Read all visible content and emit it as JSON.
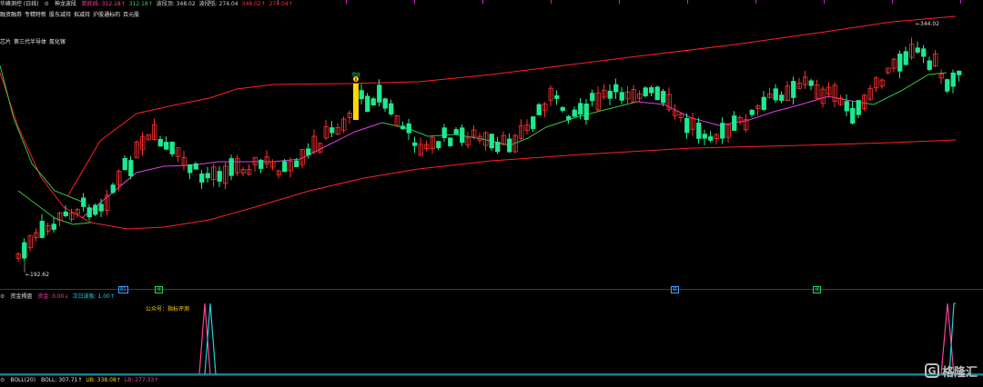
{
  "header": {
    "title": "华峰测控 (日线)",
    "indicator": "神龙波段",
    "items": [
      {
        "label": "筑底线:",
        "value": "312.18↑",
        "color": "#ff3fa0"
      },
      {
        "label": "",
        "value": "312.18↑",
        "color": "#30d060"
      },
      {
        "label": "波段顶:",
        "value": "348.02",
        "color": "#d0d0d0"
      },
      {
        "label": "波段低:",
        "value": "274.04",
        "color": "#d0d0d0"
      },
      {
        "label": "",
        "value": "348.02↑",
        "color": "#ff3030"
      },
      {
        "label": "",
        "value": "274.04↑",
        "color": "#ff3030"
      }
    ]
  },
  "tags": [
    "融资融券",
    "专精特新",
    "股东减持",
    "拟减持",
    "沪股通标的",
    "百元股"
  ],
  "concepts": [
    "芯片",
    "第三代半导体",
    "氮化镓"
  ],
  "annotations": {
    "low_label": "192.62",
    "high_label": "344.02",
    "top_text": "顶底",
    "buy_marker": "B"
  },
  "signals": [
    {
      "label": "B1",
      "color": "#40a0ff"
    },
    {
      "label": "涨",
      "color": "#30d060"
    },
    {
      "label": "跌",
      "color": "#40a0ff"
    },
    {
      "label": "涨",
      "color": "#30d060"
    }
  ],
  "sub_indicator": {
    "name": "资金揭盘",
    "items": [
      {
        "label": "资金:",
        "value": "0.00↓",
        "color": "#ff3fa0"
      },
      {
        "label": "次日波板:",
        "value": "1.00↑",
        "color": "#20d0e0"
      }
    ],
    "promo": "公众号：指标评测"
  },
  "boll": {
    "name": "BOLL(20)",
    "items": [
      {
        "label": "BOLL:",
        "value": "307.71↑",
        "color": "#e0e0e0"
      },
      {
        "label": "UB:",
        "value": "338.08↑",
        "color": "#ffd800"
      },
      {
        "label": "LB:",
        "value": "277.33↑",
        "color": "#ff3fa0"
      }
    ]
  },
  "logo": {
    "text": "格隆汇",
    "mark": "G"
  },
  "colors": {
    "up": "#ff3030",
    "down": "#20e890",
    "ma_pink": "#e040e0",
    "ma_green": "#30c840",
    "channel": "#ff2020"
  },
  "chart_data": {
    "type": "candlestick",
    "y_min": 192.62,
    "y_max": 348.02,
    "candle_count": 160,
    "low_point": 192.62,
    "high_point": 344.02
  }
}
